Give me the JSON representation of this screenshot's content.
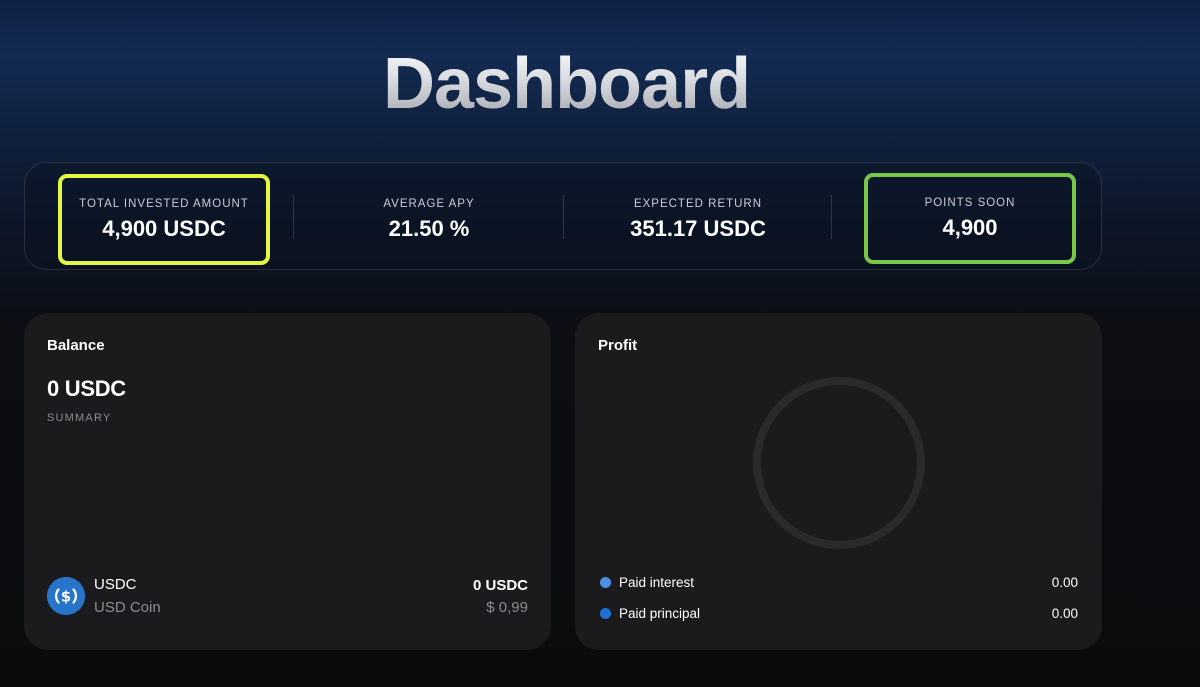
{
  "header": {
    "title": "Dashboard"
  },
  "stats": {
    "total_invested": {
      "label": "TOTAL INVESTED AMOUNT",
      "value": "4,900 USDC",
      "highlight_color": "#e4f542"
    },
    "average_apy": {
      "label": "AVERAGE APY",
      "value": "21.50 %"
    },
    "expected_return": {
      "label": "EXPECTED RETURN",
      "value": "351.17 USDC"
    },
    "points": {
      "label": "POINTS SOON",
      "value": "4,900",
      "highlight_color": "#79c74a"
    }
  },
  "balance": {
    "title": "Balance",
    "amount": "0 USDC",
    "summary_label": "SUMMARY",
    "asset": {
      "icon": "usdc-icon",
      "symbol": "USDC",
      "name": "USD Coin",
      "amount": "0 USDC",
      "usd_value": "$ 0,99"
    }
  },
  "profit": {
    "title": "Profit",
    "legend": [
      {
        "label": "Paid interest",
        "value": "0.00",
        "color": "#4a90e2"
      },
      {
        "label": "Paid principal",
        "value": "0.00",
        "color": "#1f6fd6"
      }
    ]
  },
  "colors": {
    "card_bg": "#1b1b1d",
    "usdc_blue": "#2775ca"
  }
}
